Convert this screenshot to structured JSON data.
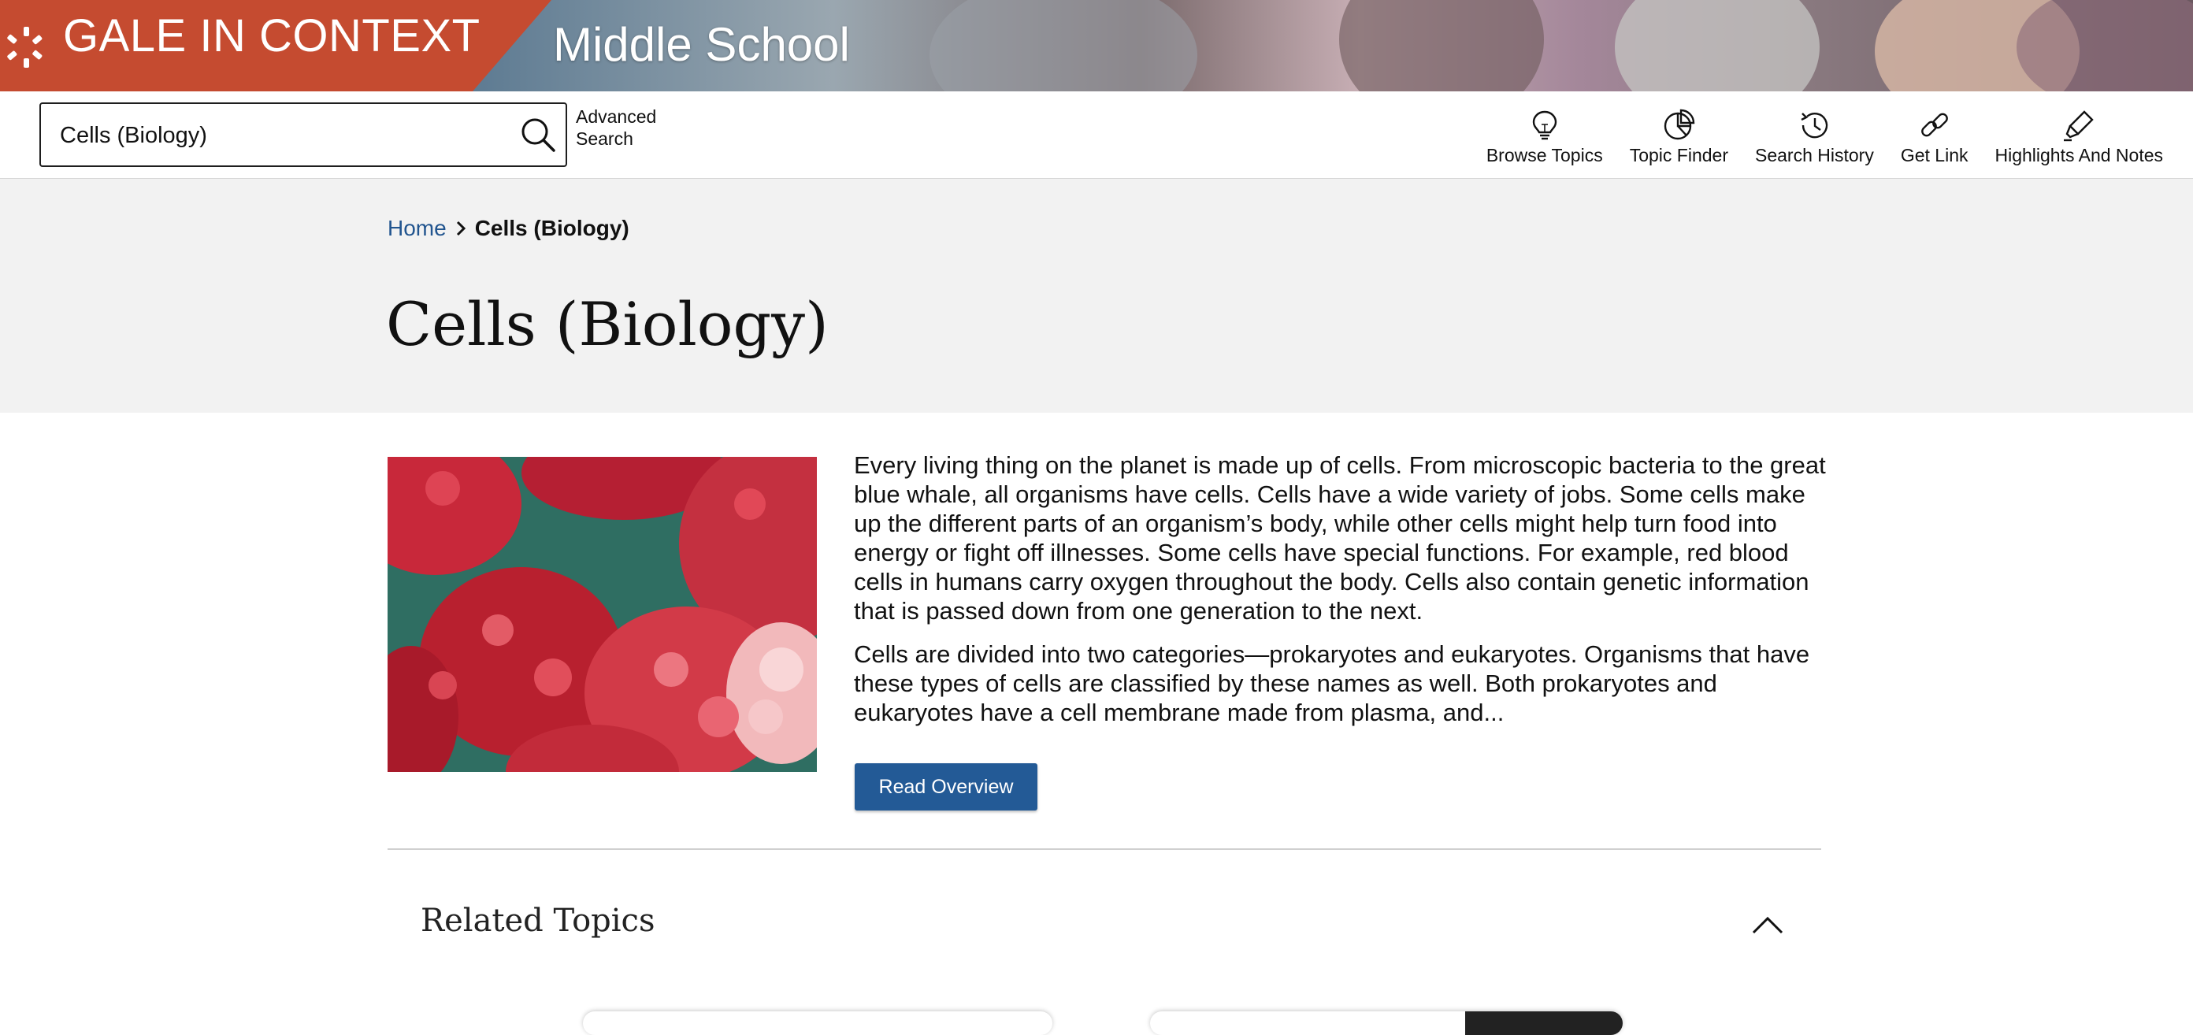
{
  "banner": {
    "brand": "GALE IN CONTEXT",
    "product": "Middle School",
    "brand_color": "#c54b30"
  },
  "search": {
    "value": "Cells (Biology)",
    "icon": "search-icon",
    "advanced_label": "Advanced Search"
  },
  "tools": [
    {
      "label": "Browse Topics",
      "icon": "lightbulb-icon"
    },
    {
      "label": "Topic Finder",
      "icon": "pie-chart-icon"
    },
    {
      "label": "Search History",
      "icon": "history-icon"
    },
    {
      "label": "Get Link",
      "icon": "link-icon"
    },
    {
      "label": "Highlights And Notes",
      "icon": "highlighter-icon"
    }
  ],
  "breadcrumb": {
    "home": "Home",
    "current": "Cells (Biology)"
  },
  "page": {
    "title": "Cells (Biology)"
  },
  "overview": {
    "paragraphs": [
      "Every living thing on the planet is made up of cells. From microscopic bacteria to the great blue whale, all organisms have cells. Cells have a wide variety of jobs. Some cells make up the different parts of an organism’s body, while other cells might help turn food into energy or fight off illnesses. Some cells have special functions. For example, red blood cells in humans carry oxygen throughout the body. Cells also contain genetic information that is passed down from one generation to the next.",
      "Cells are divided into two categories—prokaryotes and eukaryotes. Organisms that have these types of cells are classified by these names as well. Both prokaryotes and eukaryotes have a cell membrane made from plasma, and..."
    ],
    "button_label": "Read Overview",
    "button_color": "#235a96"
  },
  "related": {
    "title": "Related Topics",
    "toggle_icon": "chevron-up-icon"
  }
}
